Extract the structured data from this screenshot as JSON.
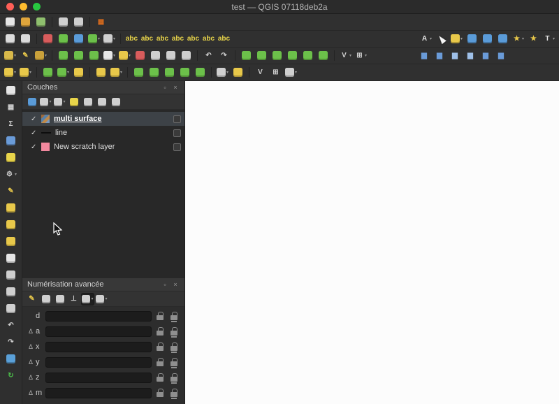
{
  "window": {
    "title": "test — QGIS 07118deb2a"
  },
  "titlebar": {
    "traffic_lights": [
      {
        "n": "close-button",
        "c": "#ff5f57"
      },
      {
        "n": "minimize-button",
        "c": "#febc2e"
      },
      {
        "n": "zoom-button",
        "c": "#28c840"
      }
    ]
  },
  "toolbars": {
    "row1": [
      {
        "n": "new-project-icon",
        "c": "#e6e6e6"
      },
      {
        "n": "open-project-icon",
        "c": "#dfa53c"
      },
      {
        "n": "save-project-icon",
        "c": "#8fbf6e"
      },
      {
        "n": "separator"
      },
      {
        "n": "new-print-layout-icon",
        "c": "#cfcfcf"
      },
      {
        "n": "show-layout-manager-icon",
        "c": "#cfcfcf"
      },
      {
        "n": "separator"
      },
      {
        "n": "style-manager-icon",
        "c": "#d2691e",
        "g": "▦"
      }
    ],
    "row2": [
      {
        "n": "pan-map-icon",
        "c": "#dcdcdc"
      },
      {
        "n": "zoom-full-icon",
        "c": "#dcdcdc"
      },
      {
        "n": "separator"
      },
      {
        "n": "new-map-view-icon",
        "c": "#d85c5c"
      },
      {
        "n": "new-3d-map-view-icon",
        "c": "#6cc04a"
      },
      {
        "n": "identify-features-icon",
        "c": "#5a9bd8"
      },
      {
        "n": "run-feature-action-icon",
        "c": "#6cc04a",
        "dd": true
      },
      {
        "n": "measure-icon",
        "c": "#cfcfcf",
        "dd": true
      },
      {
        "n": "separator"
      },
      {
        "n": "layer-labeling-icon",
        "c": "#e8d44a",
        "g": "abc"
      },
      {
        "n": "layer-diagram-icon",
        "c": "#e8d44a",
        "g": "abc"
      },
      {
        "n": "pin-labels-icon",
        "c": "#e8d44a",
        "g": "abc"
      },
      {
        "n": "highlight-labels-icon",
        "c": "#e8d44a",
        "g": "abc"
      },
      {
        "n": "move-label-icon",
        "c": "#e8d44a",
        "g": "abc"
      },
      {
        "n": "rotate-label-icon",
        "c": "#e8d44a",
        "g": "abc"
      },
      {
        "n": "change-label-icon",
        "c": "#e8d44a",
        "g": "abc"
      },
      {
        "n": "spacer"
      },
      {
        "n": "annotation-dropdown-icon",
        "c": "#e6e6e6",
        "g": "A",
        "dd": true
      },
      {
        "n": "select-tool-cursor-icon",
        "cursor": true
      },
      {
        "n": "select-features-icon",
        "c": "#e8c84a",
        "dd": true
      },
      {
        "n": "select-by-value-icon",
        "c": "#5a9bd8"
      },
      {
        "n": "deselect-all-icon",
        "c": "#5a9bd8"
      },
      {
        "n": "invert-selection-icon",
        "c": "#5a9bd8"
      },
      {
        "n": "new-bookmark-icon",
        "c": "#e8c84a",
        "g": "★",
        "dd": true
      },
      {
        "n": "show-bookmarks-icon",
        "c": "#e8c84a",
        "g": "★"
      },
      {
        "n": "text-annotation-icon",
        "c": "#e6e6e6",
        "g": "T",
        "dd": true
      }
    ],
    "row3": [
      {
        "n": "current-edits-icon",
        "c": "#d8b84a",
        "dd": true
      },
      {
        "n": "toggle-editing-icon",
        "c": "#e8c84a",
        "g": "✎"
      },
      {
        "n": "save-edits-icon",
        "c": "#c9a13b",
        "dd": true
      },
      {
        "n": "separator"
      },
      {
        "n": "add-point-feature-icon",
        "c": "#6cc04a"
      },
      {
        "n": "add-line-feature-icon",
        "c": "#6cc04a"
      },
      {
        "n": "add-polygon-feature-icon",
        "c": "#6cc04a"
      },
      {
        "n": "vertex-tool-icon",
        "c": "#e6e6e6",
        "dd": true
      },
      {
        "n": "move-feature-icon",
        "c": "#e8c84a",
        "dd": true
      },
      {
        "n": "delete-selected-icon",
        "c": "#d85c5c"
      },
      {
        "n": "cut-features-icon",
        "c": "#cfcfcf"
      },
      {
        "n": "copy-features-icon",
        "c": "#cfcfcf"
      },
      {
        "n": "paste-features-icon",
        "c": "#cfcfcf"
      },
      {
        "n": "separator"
      },
      {
        "n": "undo-icon",
        "c": "#cfcfcf",
        "g": "↶"
      },
      {
        "n": "redo-icon",
        "c": "#cfcfcf",
        "g": "↷"
      },
      {
        "n": "separator"
      },
      {
        "n": "rotate-feature-icon",
        "c": "#6cc04a"
      },
      {
        "n": "simplify-feature-icon",
        "c": "#6cc04a"
      },
      {
        "n": "add-ring-icon",
        "c": "#6cc04a"
      },
      {
        "n": "add-part-icon",
        "c": "#6cc04a"
      },
      {
        "n": "fill-ring-icon",
        "c": "#6cc04a"
      },
      {
        "n": "offset-curve-icon",
        "c": "#6cc04a"
      },
      {
        "n": "separator"
      },
      {
        "n": "vertex-editor-icon",
        "c": "#cfcfcf",
        "g": "V",
        "dd": true
      },
      {
        "n": "snapping-options-icon",
        "c": "#cfcfcf",
        "g": "⊞",
        "dd": true
      },
      {
        "n": "spacer"
      },
      {
        "n": "local-histogram-stretch-icon",
        "c": "#6a9bd8",
        "g": "▆"
      },
      {
        "n": "full-histogram-stretch-icon",
        "c": "#6a9bd8",
        "g": "▆"
      },
      {
        "n": "increase-brightness-icon",
        "c": "#9fc0e8",
        "g": "▆"
      },
      {
        "n": "decrease-brightness-icon",
        "c": "#9fc0e8",
        "g": "▆"
      },
      {
        "n": "increase-contrast-icon",
        "c": "#6a9bd8",
        "g": "▆"
      },
      {
        "n": "decrease-contrast-icon",
        "c": "#6a9bd8",
        "g": "▆"
      },
      {
        "n": "spacer"
      }
    ],
    "row4": [
      {
        "n": "enable-advanced-digitizing-icon",
        "c": "#e8c84a",
        "dd": true
      },
      {
        "n": "move-feature-copy-icon",
        "c": "#e8c84a",
        "dd": true
      },
      {
        "n": "separator"
      },
      {
        "n": "rotate-feature-adv-icon",
        "c": "#6cc04a"
      },
      {
        "n": "simplify-adv-icon",
        "c": "#6cc04a",
        "dd": true
      },
      {
        "n": "scale-feature-icon",
        "c": "#e8c84a"
      },
      {
        "n": "separator"
      },
      {
        "n": "move-feature2-icon",
        "c": "#e8c84a"
      },
      {
        "n": "copy-move-feature-icon",
        "c": "#e8c84a",
        "dd": true
      },
      {
        "n": "separator"
      },
      {
        "n": "reshape-features-icon",
        "c": "#6cc04a"
      },
      {
        "n": "split-features-icon",
        "c": "#6cc04a"
      },
      {
        "n": "split-parts-icon",
        "c": "#6cc04a"
      },
      {
        "n": "merge-features-icon",
        "c": "#6cc04a"
      },
      {
        "n": "merge-attributes-icon",
        "c": "#6cc04a"
      },
      {
        "n": "separator"
      },
      {
        "n": "measure-adv-icon",
        "c": "#cfcfcf",
        "dd": true
      },
      {
        "n": "offset-point-symbol-icon",
        "c": "#e8c84a"
      },
      {
        "n": "separator"
      },
      {
        "n": "vertex-symbol-icon",
        "c": "#cfcfcf",
        "g": "V"
      },
      {
        "n": "grid-plus-icon",
        "c": "#cfcfcf",
        "g": "⊞"
      },
      {
        "n": "trim-extend-icon",
        "c": "#cfcfcf",
        "dd": true
      }
    ]
  },
  "left_toolbar": [
    {
      "n": "pan-hand-icon",
      "c": "#e6e6e6"
    },
    {
      "n": "browser-grid-icon",
      "c": "#cfcfcf",
      "g": "▦"
    },
    {
      "n": "statistics-icon",
      "c": "#cfcfcf",
      "g": "Σ"
    },
    {
      "n": "attribute-table-icon",
      "c": "#6a9bd8"
    },
    {
      "n": "map-tips-icon",
      "c": "#e8d44a"
    },
    {
      "n": "options-gear-icon",
      "c": "#cfcfcf",
      "g": "⚙",
      "dd": true
    },
    {
      "n": "edit-pencil-icon",
      "c": "#e8c84a",
      "g": "✎"
    },
    {
      "n": "add-feature-icon",
      "c": "#e8c84a"
    },
    {
      "n": "digitize-shape-icon",
      "c": "#e8c84a"
    },
    {
      "n": "annotation-icon",
      "c": "#e8c84a"
    },
    {
      "n": "move-annotation-icon",
      "c": "#e6e6e6"
    },
    {
      "n": "form-annotation-icon",
      "c": "#cfcfcf"
    },
    {
      "n": "svg-annotation-icon",
      "c": "#cfcfcf"
    },
    {
      "n": "clipboard-icon",
      "c": "#cfcfcf"
    },
    {
      "n": "undo-arrow-icon",
      "c": "#cfcfcf",
      "g": "↶"
    },
    {
      "n": "redo-arrow-icon",
      "c": "#cfcfcf",
      "g": "↷"
    },
    {
      "n": "temporal-controller-icon",
      "c": "#5aa0d8"
    },
    {
      "n": "refresh-map-icon",
      "c": "#4cc04a",
      "g": "↻"
    }
  ],
  "panels": {
    "layers": {
      "title": "Couches",
      "check_glyph": "✓",
      "header_icons": [
        {
          "n": "float-panel-icon",
          "g": "▫"
        },
        {
          "n": "close-panel-icon",
          "g": "×"
        }
      ],
      "toolbar": [
        {
          "n": "open-layer-styling-icon",
          "c": "#5a9bd8"
        },
        {
          "n": "filter-legend-icon",
          "c": "#cfcfcf",
          "dd": true
        },
        {
          "n": "manage-map-themes-icon",
          "c": "#cfcfcf",
          "dd": true
        },
        {
          "n": "filter-legend-expression-icon",
          "c": "#e8d44a"
        },
        {
          "n": "expand-all-icon",
          "c": "#cfcfcf"
        },
        {
          "n": "collapse-all-icon",
          "c": "#cfcfcf"
        },
        {
          "n": "remove-layer-icon",
          "c": "#cfcfcf"
        }
      ],
      "items": [
        {
          "n": "layer-item-multi-surface",
          "label": "multi surface",
          "type": "raster",
          "selected": true
        },
        {
          "n": "layer-item-line",
          "label": "line",
          "type": "line"
        },
        {
          "n": "layer-item-new-scratch-layer",
          "label": "New scratch layer",
          "type": "scratch",
          "c": "#f2889e"
        }
      ]
    },
    "advanced_digitizing": {
      "title": "Numérisation avancée",
      "delta_symbol": "Δ",
      "header_icons": [
        {
          "n": "float-panel-icon",
          "g": "▫"
        },
        {
          "n": "close-panel-icon",
          "g": "×"
        }
      ],
      "toolbar": [
        {
          "n": "enable-advanced-digitizing-icon",
          "c": "#e8c84a",
          "g": "✎"
        },
        {
          "n": "construction-mode-icon",
          "c": "#cfcfcf"
        },
        {
          "n": "parallel-constraint-icon",
          "c": "#cfcfcf"
        },
        {
          "n": "perpendicular-constraint-icon",
          "c": "#cfcfcf",
          "g": "⊥"
        },
        {
          "n": "snap-to-common-angles-icon",
          "c": "#cfcfcf",
          "pressed": true,
          "dd": true
        },
        {
          "n": "floater-icon",
          "c": "#cfcfcf",
          "dd": true
        }
      ],
      "rows": [
        {
          "label": "d",
          "delta": false
        },
        {
          "label": "a",
          "delta": true
        },
        {
          "label": "x",
          "delta": true
        },
        {
          "label": "y",
          "delta": true
        },
        {
          "label": "z",
          "delta": true
        },
        {
          "label": "m",
          "delta": true
        }
      ]
    }
  }
}
